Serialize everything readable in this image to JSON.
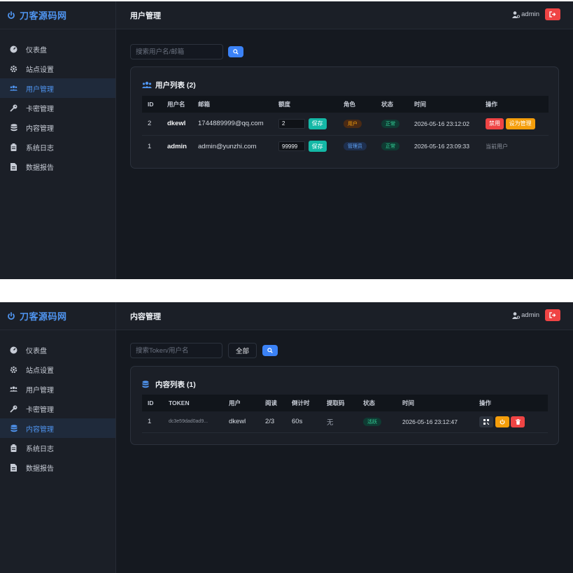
{
  "brand": {
    "name": "刀客源码网"
  },
  "sidebar": {
    "items": [
      {
        "label": "仪表盘",
        "icon": "dashboard-icon"
      },
      {
        "label": "站点设置",
        "icon": "gear-icon"
      },
      {
        "label": "用户管理",
        "icon": "users-icon"
      },
      {
        "label": "卡密管理",
        "icon": "key-icon"
      },
      {
        "label": "内容管理",
        "icon": "database-icon"
      },
      {
        "label": "系统日志",
        "icon": "clipboard-icon"
      },
      {
        "label": "数据报告",
        "icon": "file-icon"
      }
    ]
  },
  "header": {
    "admin_name": "admin"
  },
  "colors": {
    "accent": "#4f94ef",
    "danger": "#ef4444",
    "success": "#14b8a6",
    "warning": "#f59e0b"
  },
  "users_page": {
    "title": "用户管理",
    "active_nav": 2,
    "search": {
      "placeholder": "搜索用户名/邮箱",
      "value": ""
    },
    "card_title": "用户列表 (2)",
    "columns": [
      "ID",
      "用户名",
      "邮箱",
      "额度",
      "角色",
      "状态",
      "时间",
      "操作"
    ],
    "rows": [
      {
        "id": "2",
        "username": "dkewl",
        "email": "1744889999@qq.com",
        "quota": "2",
        "save_label": "保存",
        "role": "用户",
        "status": "正常",
        "time": "2026-05-16 23:12:02",
        "ban_label": "禁用",
        "promote_label": "设为管理"
      },
      {
        "id": "1",
        "username": "admin",
        "email": "admin@yunzhi.com",
        "quota": "99999",
        "save_label": "保存",
        "role": "管理员",
        "status": "正常",
        "time": "2026-05-16 23:09:33",
        "note": "当前用户"
      }
    ]
  },
  "content_page": {
    "title": "内容管理",
    "active_nav": 4,
    "search": {
      "placeholder": "搜索Token/用户名",
      "value": ""
    },
    "filter": {
      "selected": "全部"
    },
    "card_title": "内容列表 (1)",
    "columns": [
      "ID",
      "TOKEN",
      "用户",
      "阅读",
      "倒计时",
      "提取码",
      "状态",
      "时间",
      "操作"
    ],
    "rows": [
      {
        "id": "1",
        "token": "dc3e59dad0ad9...",
        "user": "dkewl",
        "reads": "2/3",
        "countdown": "60s",
        "code": "无",
        "status": "活跃",
        "time": "2026-05-16 23:12:47"
      }
    ]
  }
}
